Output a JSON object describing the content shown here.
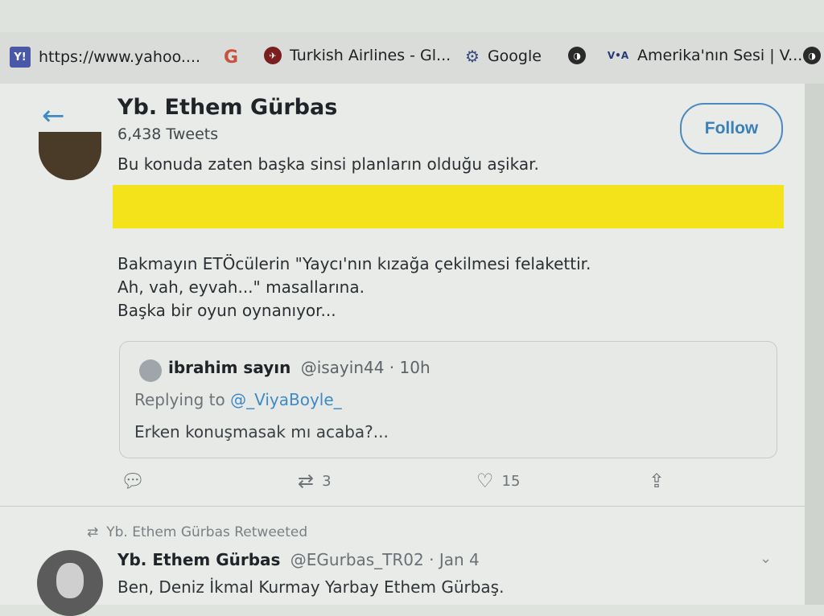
{
  "bookmarks": [
    {
      "icon": "yahoo-icon",
      "label": "https://www.yahoo...."
    },
    {
      "icon": "google-g-icon",
      "label": ""
    },
    {
      "icon": "turkish-airlines-icon",
      "label": "Turkish Airlines - Gl..."
    },
    {
      "icon": "google-icon",
      "label": "Google"
    },
    {
      "icon": "globe-icon",
      "label": ""
    },
    {
      "icon": "voa-icon",
      "label": "Amerika'nın Sesi | V..."
    },
    {
      "icon": "globe-icon",
      "label": ""
    }
  ],
  "header": {
    "name": "Yb. Ethem Gürbas",
    "tweet_count": "6,438 Tweets",
    "follow_label": "Follow"
  },
  "tweet1": {
    "line1": "Bu konuda zaten başka sinsi planların olduğu aşikar.",
    "para": [
      "Bakmayın ETÖcülerin \"Yaycı'nın kızağa çekilmesi felakettir.",
      "Ah, vah, eyvah...\" masallarına.",
      "Başka bir oyun oynanıyor..."
    ],
    "quote": {
      "name": "ibrahim sayın",
      "handle": "@isayin44 · 10h",
      "replying_prefix": "Replying to ",
      "replying_to": "@_ViyaBoyle_",
      "text": "Erken konuşmasak mı acaba?..."
    },
    "actions": {
      "retweets": "3",
      "likes": "15"
    }
  },
  "tweet2": {
    "retweeted_label": "Yb. Ethem Gürbas Retweeted",
    "name": "Yb. Ethem Gürbas",
    "handle": "@EGurbas_TR02 · Jan 4",
    "text": "Ben, Deniz İkmal Kurmay Yarbay Ethem Gürbaş."
  },
  "colors": {
    "accent": "#3f89c6",
    "highlight": "#f4e31a"
  }
}
